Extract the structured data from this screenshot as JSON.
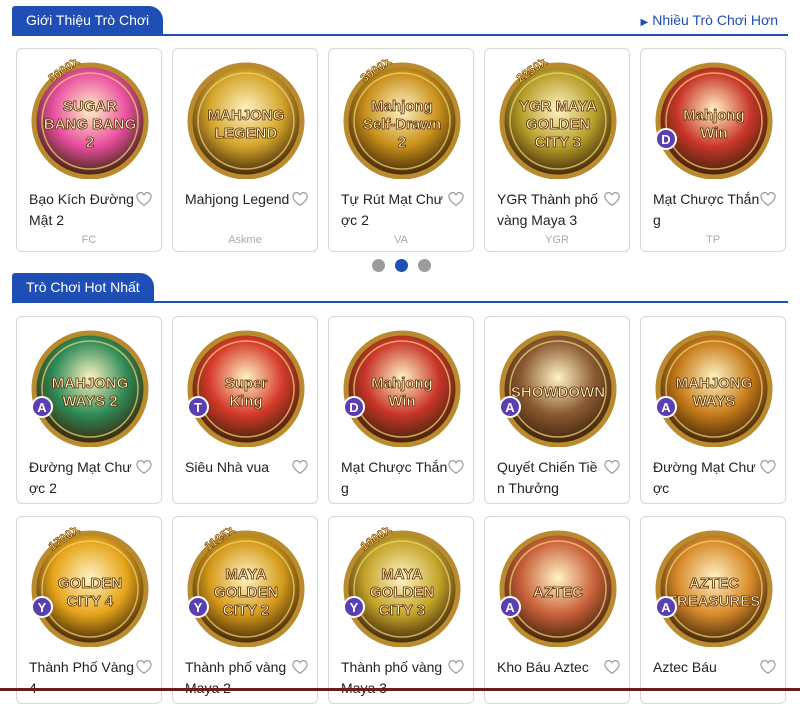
{
  "featured": {
    "title": "Giới Thiệu Trò Chơi",
    "more_label": "Nhiều Trò Chơi Hơn",
    "games": [
      {
        "name": "Bạo Kích Đường Mật 2",
        "vendor": "FC",
        "badge": "",
        "art": "SUGAR BANG BANG 2",
        "multiplier": "5000X",
        "color": "#e94fa0"
      },
      {
        "name": "Mahjong Legend",
        "vendor": "Askme",
        "badge": "",
        "art": "MAHJONG LEGEND",
        "multiplier": "",
        "color": "#d4a52a"
      },
      {
        "name": "Tự Rút Mạt Chược 2",
        "vendor": "VA",
        "badge": "",
        "art": "Mahjong Self-Drawn 2",
        "multiplier": "3000X",
        "color": "#c8901a"
      },
      {
        "name": "YGR Thành phố vàng Maya 3",
        "vendor": "YGR",
        "badge": "",
        "art": "YGR MAYA GOLDEN CITY 3",
        "multiplier": "2250X",
        "color": "#b8a02a"
      },
      {
        "name": "Mạt Chược Thắng",
        "vendor": "TP",
        "badge": "D",
        "art": "Mahjong Win",
        "multiplier": "",
        "color": "#c9362a"
      }
    ]
  },
  "hot": {
    "title": "Trò Chơi Hot Nhất",
    "games": [
      {
        "name": "Đường Mạt Chược 2",
        "badge": "A",
        "art": "MAHJONG WAYS 2",
        "color": "#2e8b57"
      },
      {
        "name": "Siêu Nhà vua",
        "badge": "T",
        "art": "Super King",
        "color": "#d63a2a"
      },
      {
        "name": "Mạt Chược Thắng",
        "badge": "D",
        "art": "Mahjong Win",
        "color": "#c9362a"
      },
      {
        "name": "Quyết Chiến Tiền Thưởng",
        "badge": "A",
        "art": "SHOWDOWN",
        "color": "#8a5a32"
      },
      {
        "name": "Đường Mạt Chược",
        "badge": "A",
        "art": "MAHJONG WAYS",
        "color": "#c67b1a"
      },
      {
        "name": "Thành Phố Vàng 4",
        "badge": "Y",
        "art": "GOLDEN CITY 4",
        "multiplier": "1700X",
        "color": "#e6a51a"
      },
      {
        "name": "Thành phố vàng Maya 2",
        "badge": "Y",
        "art": "MAYA GOLDEN CITY 2",
        "multiplier": "1125X",
        "color": "#d49a1a"
      },
      {
        "name": "Thành phố vàng Maya 3",
        "badge": "Y",
        "art": "MAYA GOLDEN CITY 3",
        "multiplier": "1000X",
        "color": "#c4a52a"
      },
      {
        "name": "Kho Báu Aztec",
        "badge": "A",
        "art": "AZTEC",
        "color": "#c9613a"
      },
      {
        "name": "Aztec Báu",
        "badge": "A",
        "art": "AZTEC TREASURES",
        "color": "#d88a2a"
      }
    ]
  },
  "carousel": {
    "current": 2,
    "total": 3
  }
}
